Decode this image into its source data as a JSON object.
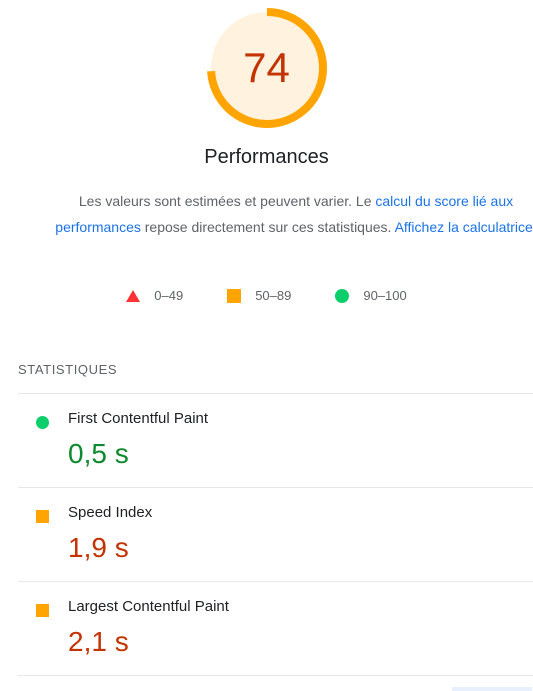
{
  "gauge": {
    "score": "74",
    "score_fraction": 0.74,
    "color_arc": "#ffa400",
    "color_fill": "#fff3e0",
    "color_text": "#c33300"
  },
  "category": {
    "title": "Performances"
  },
  "description": {
    "part1": "Les valeurs sont estimées et peuvent varier. Le ",
    "link1": "calcul du score lié aux performances",
    "part2": " repose directement sur ces statistiques. ",
    "link2": "Affichez la calculatrice",
    "part3": "."
  },
  "legend": {
    "fail": "0–49",
    "average": "50–89",
    "pass": "90–100"
  },
  "statistics": {
    "heading": "STATISTIQUES",
    "metrics": [
      {
        "name": "First Contentful Paint",
        "value": "0,5 s",
        "rating": "pass"
      },
      {
        "name": "Speed Index",
        "value": "1,9 s",
        "rating": "average"
      },
      {
        "name": "Largest Contentful Paint",
        "value": "2,1 s",
        "rating": "average"
      }
    ]
  },
  "colors": {
    "fail": "#ff3333",
    "average": "#ffa400",
    "pass": "#0cce6b",
    "link": "#1a73e8"
  }
}
